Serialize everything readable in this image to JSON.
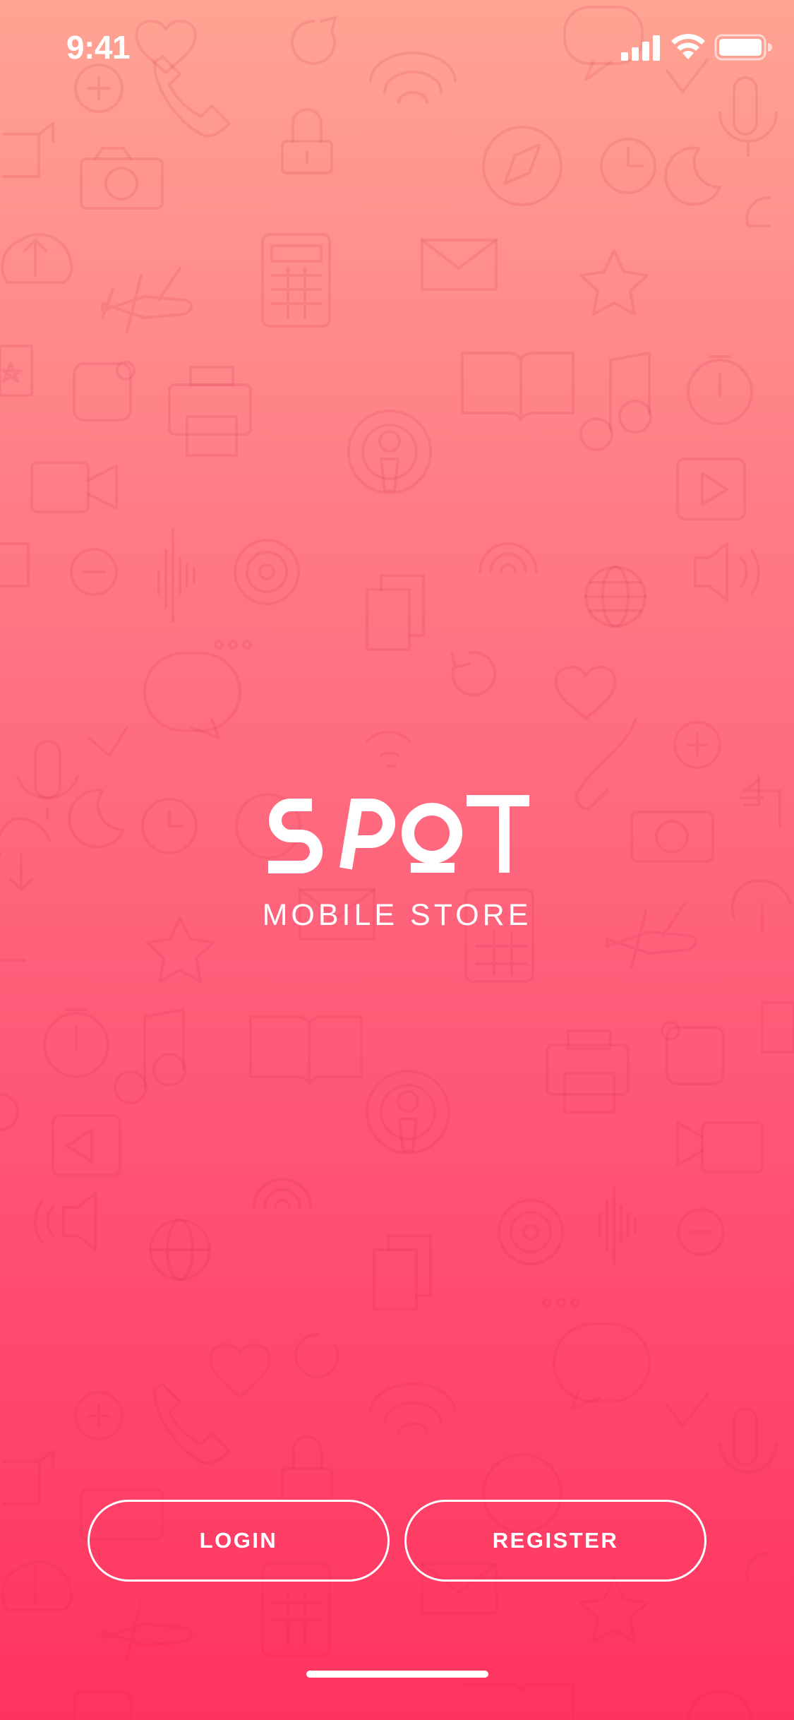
{
  "status_bar": {
    "time": "9:41",
    "icons": [
      "signal-icon",
      "wifi-icon",
      "battery-icon"
    ]
  },
  "brand": {
    "logo_text": "SPOT",
    "tagline": "MOBILE STORE"
  },
  "actions": {
    "login_label": "LOGIN",
    "register_label": "REGISTER"
  },
  "colors": {
    "gradient_top": "#ffa493",
    "gradient_bottom": "#ff335f",
    "foreground": "#ffffff"
  }
}
